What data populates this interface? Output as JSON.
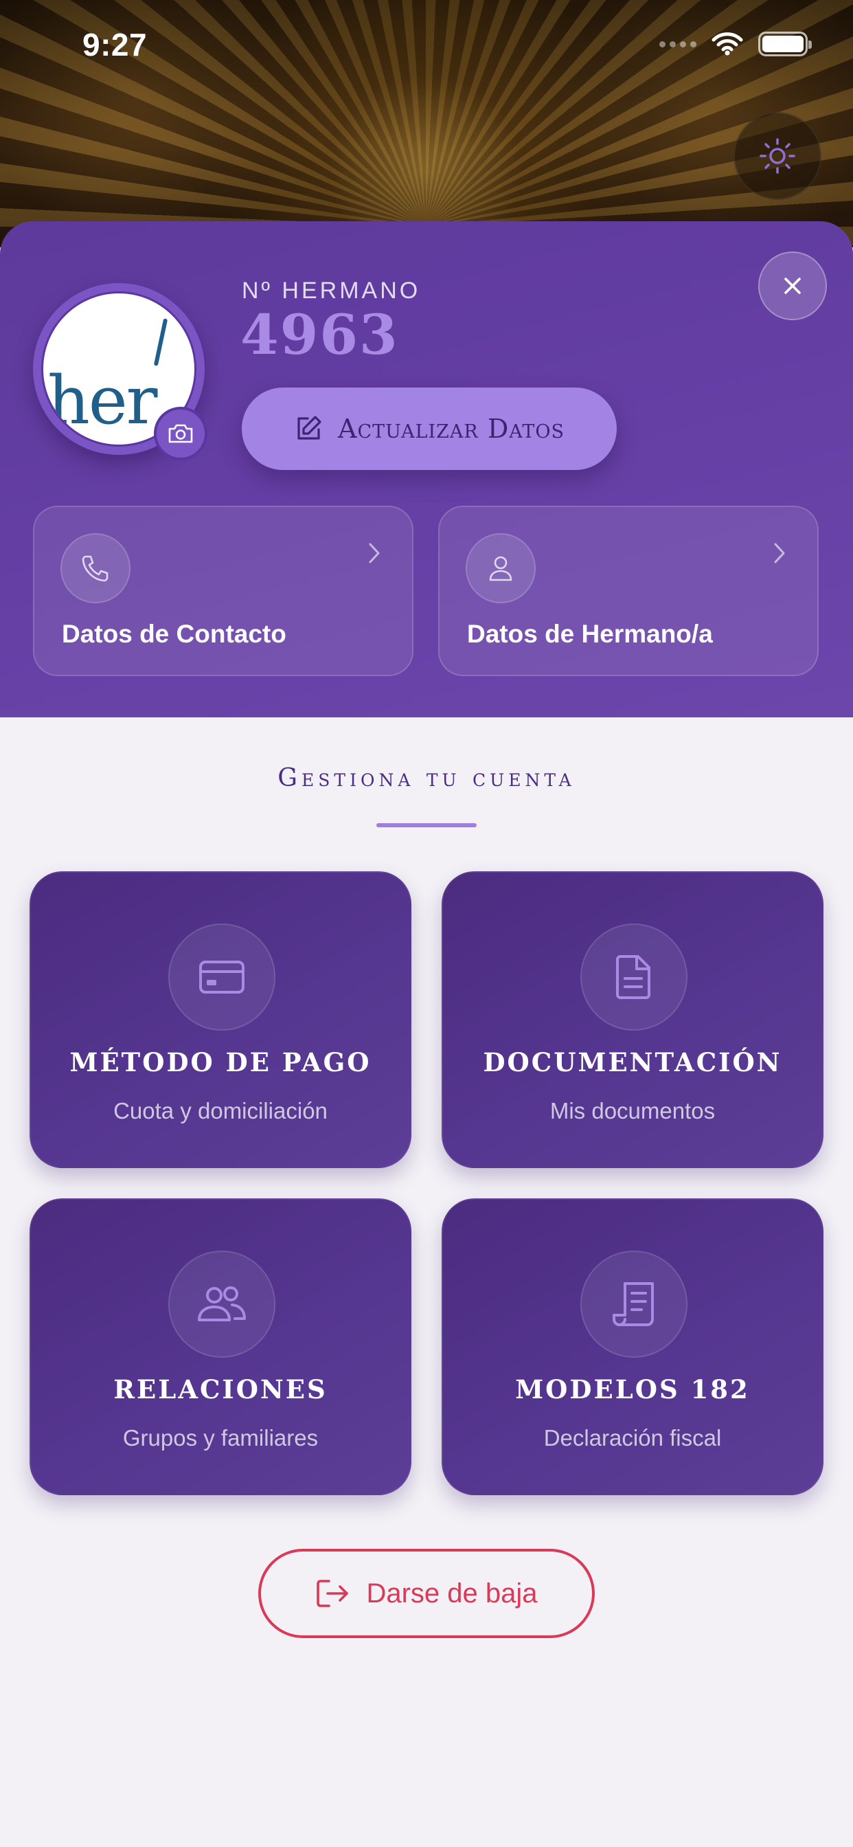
{
  "status_bar": {
    "time": "9:27"
  },
  "profile": {
    "member_label": "Nº HERMANO",
    "member_number": "4963",
    "update_button_label": "Actualizar Datos",
    "cards": [
      {
        "label": "Datos de Contacto",
        "icon": "phone-icon"
      },
      {
        "label": "Datos de Hermano/a",
        "icon": "user-icon"
      }
    ]
  },
  "manage": {
    "title": "Gestiona tu cuenta",
    "tiles": [
      {
        "title": "MÉTODO DE PAGO",
        "subtitle": "Cuota y domiciliación",
        "icon": "credit-card-icon"
      },
      {
        "title": "DOCUMENTACIÓN",
        "subtitle": "Mis documentos",
        "icon": "document-icon"
      },
      {
        "title": "RELACIONES",
        "subtitle": "Grupos y familiares",
        "icon": "users-icon"
      },
      {
        "title": "MODELOS 182",
        "subtitle": "Declaración fiscal",
        "icon": "receipt-icon"
      }
    ]
  },
  "leave_button_label": "Darse de baja",
  "colors": {
    "accent": "#a383e3",
    "card_purple": "#643ea3",
    "tile_purple": "#553690",
    "danger": "#d83a58",
    "background": "#f3f1f6"
  }
}
